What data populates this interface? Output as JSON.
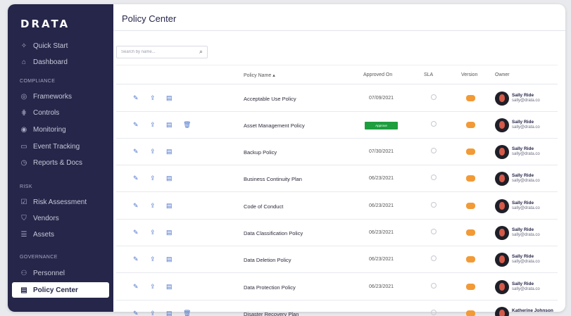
{
  "app": {
    "logo": "DRATA"
  },
  "sidebar": {
    "top_items": [
      {
        "label": "Quick Start",
        "icon": "sparkle-icon"
      },
      {
        "label": "Dashboard",
        "icon": "home-icon"
      }
    ],
    "sections": [
      {
        "label": "COMPLIANCE",
        "items": [
          {
            "label": "Frameworks",
            "icon": "compass-icon"
          },
          {
            "label": "Controls",
            "icon": "controls-icon"
          },
          {
            "label": "Monitoring",
            "icon": "monitoring-icon"
          },
          {
            "label": "Event Tracking",
            "icon": "calendar-icon"
          },
          {
            "label": "Reports & Docs",
            "icon": "clock-icon"
          }
        ]
      },
      {
        "label": "RISK",
        "items": [
          {
            "label": "Risk Assessment",
            "icon": "checklist-icon"
          },
          {
            "label": "Vendors",
            "icon": "shield-icon"
          },
          {
            "label": "Assets",
            "icon": "list-icon"
          }
        ]
      },
      {
        "label": "GOVERNANCE",
        "items": [
          {
            "label": "Personnel",
            "icon": "people-icon"
          },
          {
            "label": "Policy Center",
            "icon": "document-icon",
            "active": true
          }
        ]
      }
    ]
  },
  "header": {
    "title": "Policy Center"
  },
  "search": {
    "placeholder": "Search by name..."
  },
  "table": {
    "columns": {
      "policy_name": "Policy Name",
      "approved_on": "Approved On",
      "sla": "SLA",
      "version": "Version",
      "owner": "Owner"
    },
    "rows": [
      {
        "name": "Acceptable Use Policy",
        "approved_on": "07/09/2021",
        "owner_name": "Sally Ride",
        "owner_email": "sally@drata.co",
        "has_delete": false,
        "approve_button": false
      },
      {
        "name": "Asset Management Policy",
        "approved_on": "",
        "owner_name": "Sally Ride",
        "owner_email": "sally@drata.co",
        "has_delete": true,
        "approve_button": true,
        "approve_label": "Approve"
      },
      {
        "name": "Backup Policy",
        "approved_on": "07/30/2021",
        "owner_name": "Sally Ride",
        "owner_email": "sally@drata.co",
        "has_delete": false,
        "approve_button": false
      },
      {
        "name": "Business Continuity Plan",
        "approved_on": "06/23/2021",
        "owner_name": "Sally Ride",
        "owner_email": "sally@drata.co",
        "has_delete": false,
        "approve_button": false
      },
      {
        "name": "Code of Conduct",
        "approved_on": "06/23/2021",
        "owner_name": "Sally Ride",
        "owner_email": "sally@drata.co",
        "has_delete": false,
        "approve_button": false
      },
      {
        "name": "Data Classification Policy",
        "approved_on": "06/23/2021",
        "owner_name": "Sally Ride",
        "owner_email": "sally@drata.co",
        "has_delete": false,
        "approve_button": false
      },
      {
        "name": "Data Deletion Policy",
        "approved_on": "06/23/2021",
        "owner_name": "Sally Ride",
        "owner_email": "sally@drata.co",
        "has_delete": false,
        "approve_button": false
      },
      {
        "name": "Data Protection Policy",
        "approved_on": "06/23/2021",
        "owner_name": "Sally Ride",
        "owner_email": "sally@drata.co",
        "has_delete": false,
        "approve_button": false
      },
      {
        "name": "Disaster Recovery Plan",
        "approved_on": "",
        "owner_name": "Katherine Johnson",
        "owner_email": "",
        "has_delete": true,
        "approve_button": false
      }
    ]
  },
  "colors": {
    "sidebar_bg": "#26264a",
    "accent_icon": "#4a72c9",
    "approve_green": "#1e9e3f",
    "version_orange": "#f29a36"
  }
}
